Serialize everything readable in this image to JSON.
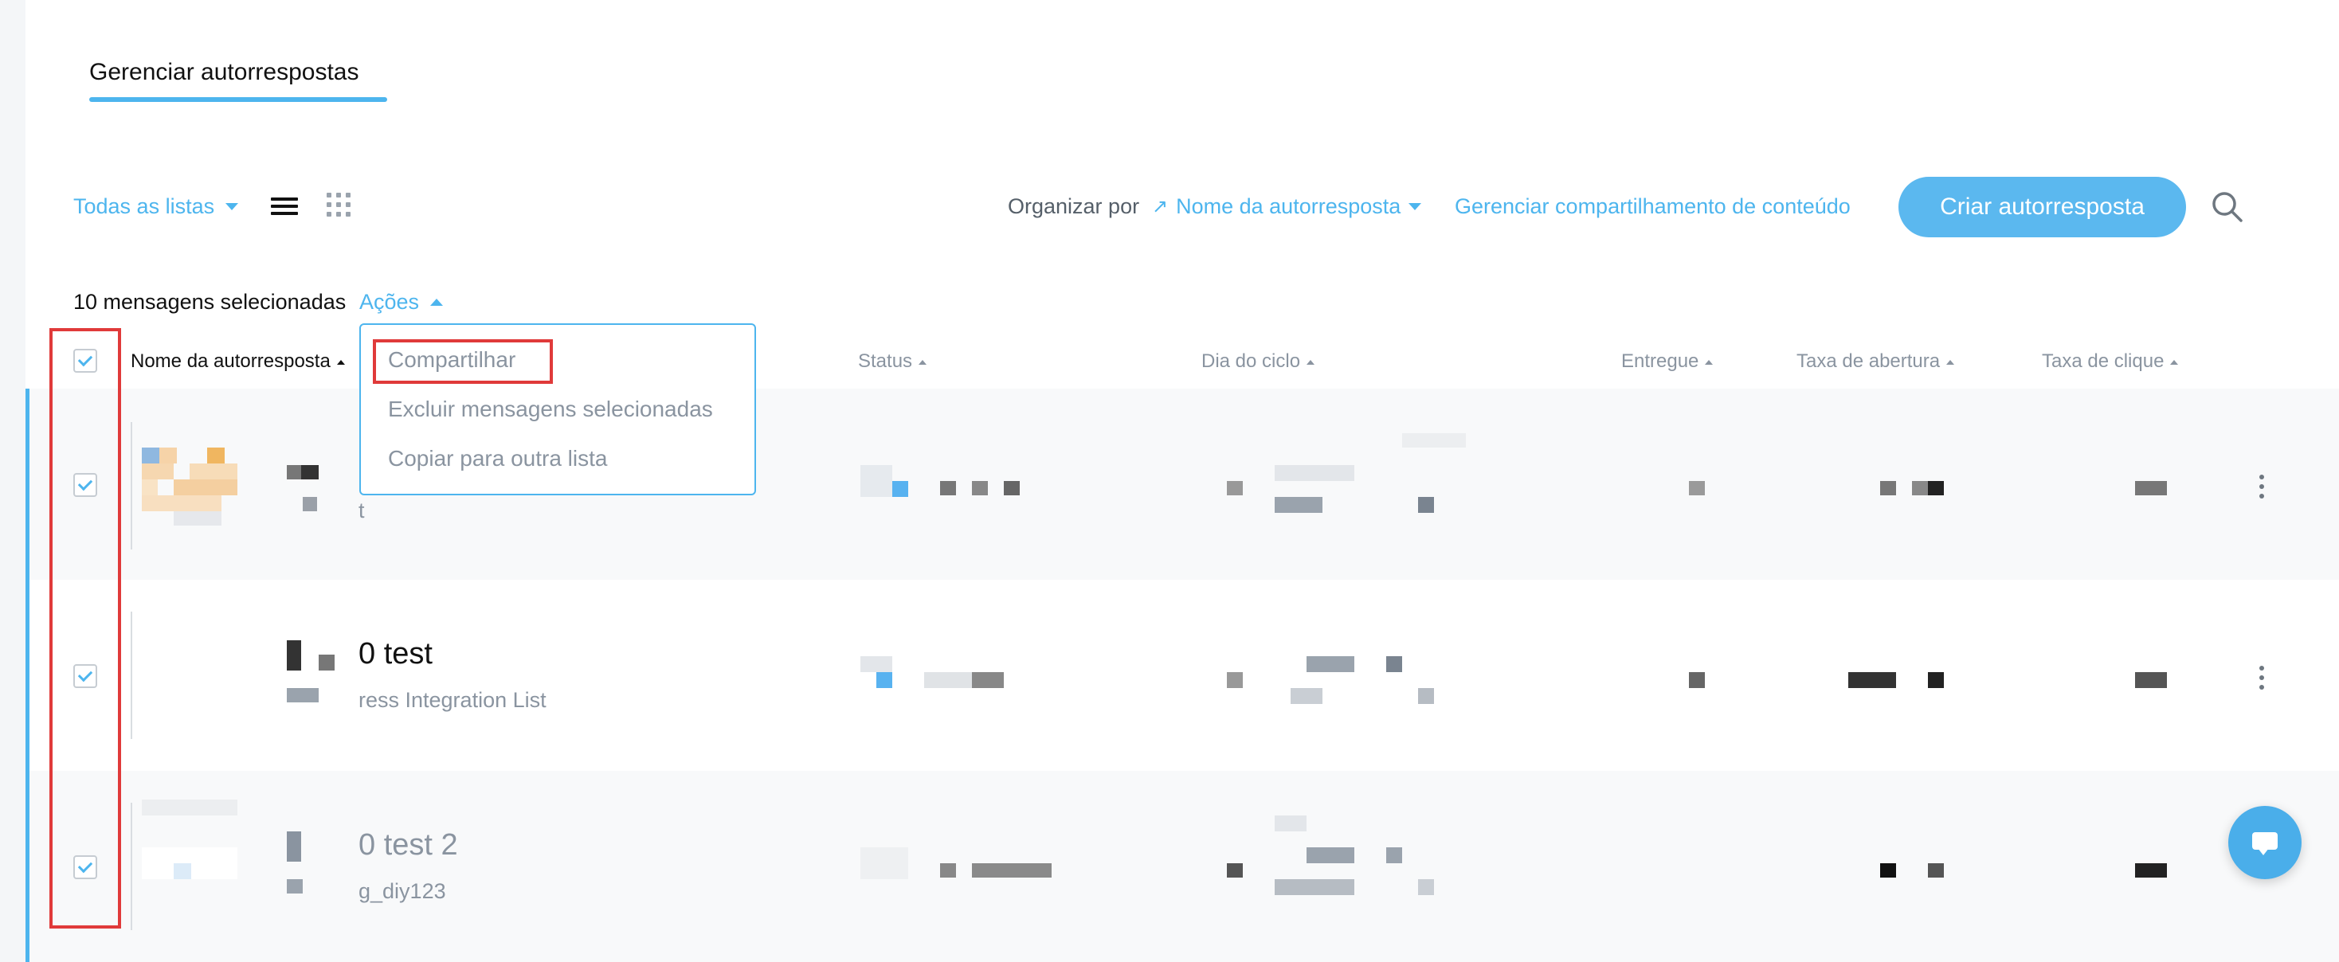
{
  "page": {
    "tab_title": "Gerenciar autorrespostas"
  },
  "toolbar": {
    "lists_filter": "Todas as listas",
    "sort_label": "Organizar por",
    "sort_value": "Nome da autorresposta",
    "sharing_link": "Gerenciar compartilhamento de conteúdo",
    "create_button": "Criar autorresposta"
  },
  "selection": {
    "count_text": "10 mensagens selecionadas",
    "actions_label": "Ações",
    "menu": [
      "Compartilhar",
      "Excluir mensagens selecionadas",
      "Copiar para outra lista"
    ]
  },
  "table": {
    "columns": [
      "Nome da autorresposta",
      "Status",
      "Dia do ciclo",
      "Entregue",
      "Taxa de abertura",
      "Taxa de clique"
    ],
    "rows": [
      {
        "title": "",
        "subtitle": "t",
        "checked": true
      },
      {
        "title": "0 test",
        "subtitle": "ress Integration List",
        "checked": true
      },
      {
        "title": "0 test 2",
        "subtitle": "g_diy123",
        "checked": true
      }
    ]
  },
  "colors": {
    "accent": "#4db5ee",
    "highlight": "#e03a3a",
    "button": "#5bb8ef"
  },
  "icons": [
    "list-view-icon",
    "grid-view-icon",
    "search-icon",
    "kebab-menu-icon",
    "chat-icon",
    "checkbox-check-icon"
  ]
}
